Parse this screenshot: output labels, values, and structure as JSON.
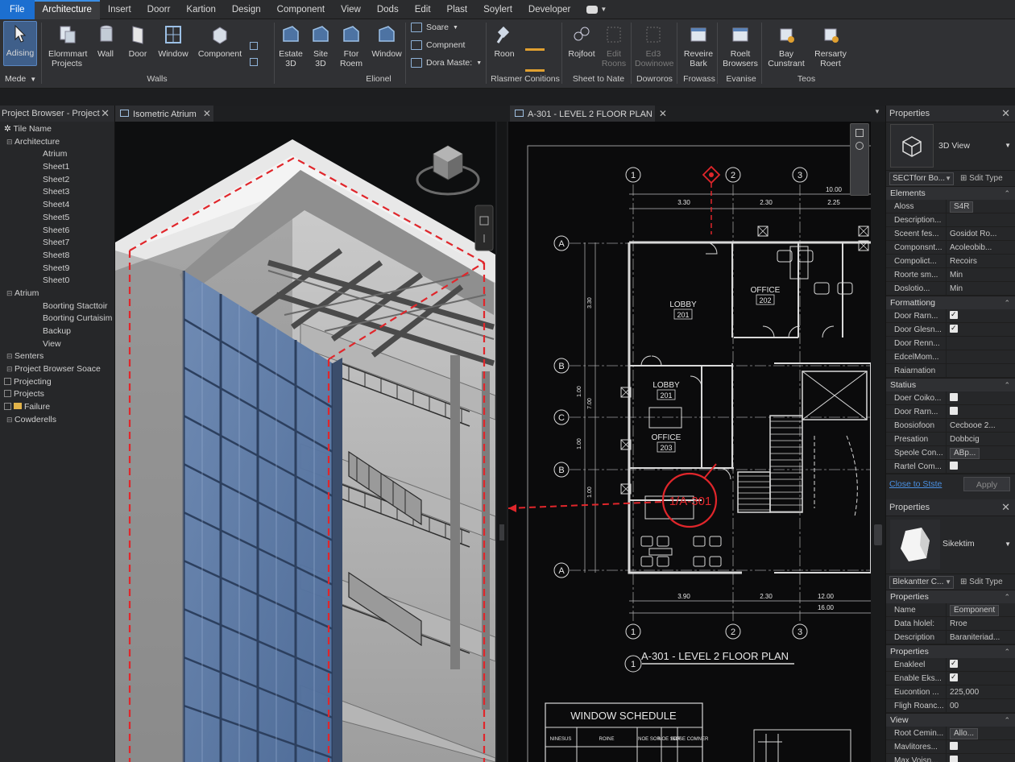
{
  "menu": {
    "items": [
      "File",
      "Architecture",
      "Insert",
      "Doorr",
      "Kartion",
      "Design",
      "Component",
      "View",
      "Dods",
      "Edit",
      "Plast",
      "Soylert",
      "Developer"
    ],
    "active": "Architecture"
  },
  "ribbon": {
    "modify": {
      "label": "Adising",
      "footer": "Mede"
    },
    "buttons": [
      {
        "id": "elements-projects",
        "label": "Elormmart\nProjects"
      },
      {
        "id": "wall",
        "label": "Wall"
      },
      {
        "id": "door",
        "label": "Door"
      },
      {
        "id": "window",
        "label": "Window"
      },
      {
        "id": "component",
        "label": "Component"
      },
      {
        "id": "estate-3d",
        "label": "Estate\n3D"
      },
      {
        "id": "site-3d",
        "label": "Site\n3D"
      },
      {
        "id": "floor-room",
        "label": "Ftor\nRoem"
      },
      {
        "id": "window-2",
        "label": "Window"
      },
      {
        "id": "room",
        "label": "Roon"
      },
      {
        "id": "project",
        "label": "Rojfoot"
      },
      {
        "id": "edit-rooms",
        "label": "Edit\nRoons"
      },
      {
        "id": "edit-dowinowe",
        "label": "Ed3\nDowinowe"
      },
      {
        "id": "review-bark",
        "label": "Reveire\nBark"
      },
      {
        "id": "roelt-browsers",
        "label": "Roelt\nBrowsers"
      },
      {
        "id": "bay-cunstrant",
        "label": "Bay\nCunstrant"
      },
      {
        "id": "rersarty-roert",
        "label": "Rersarty\nRoert"
      }
    ],
    "small_buttons": [
      "Soare",
      "Compnent",
      "Dora Maste:"
    ],
    "groups": [
      "Walls",
      "Elionel",
      "Rlasmer Conitions",
      "Sheet to Nate",
      "Dowroros",
      "Frowass",
      "Evanise",
      "Teos"
    ]
  },
  "project_browser": {
    "title": "Project Browser - Project",
    "tree": [
      {
        "label": "Tile Name",
        "level": 0,
        "icon": "star"
      },
      {
        "label": "Architecture",
        "level": 1
      },
      {
        "label": "Atrium",
        "level": 2
      },
      {
        "label": "Sheet1",
        "level": 2
      },
      {
        "label": "Sheet2",
        "level": 2
      },
      {
        "label": "Sheet3",
        "level": 2
      },
      {
        "label": "Sheet4",
        "level": 2
      },
      {
        "label": "Sheet5",
        "level": 2
      },
      {
        "label": "Sheet6",
        "level": 2
      },
      {
        "label": "Sheet7",
        "level": 2
      },
      {
        "label": "Sheet8",
        "level": 2
      },
      {
        "label": "Sheet9",
        "level": 2
      },
      {
        "label": "Sheet0",
        "level": 2
      },
      {
        "label": "Atrium",
        "level": 1
      },
      {
        "label": "Boorting Stacttoir",
        "level": 2
      },
      {
        "label": "Boorting Curtaisim",
        "level": 2
      },
      {
        "label": "Backup",
        "level": 2
      },
      {
        "label": "View",
        "level": 2
      },
      {
        "label": "Senters",
        "level": 1
      },
      {
        "label": "Project Browser Soace",
        "level": 1
      },
      {
        "label": "Projecting",
        "level": 0,
        "exp": true
      },
      {
        "label": "Projects",
        "level": 0,
        "exp": true
      },
      {
        "label": "Failure",
        "level": 0,
        "exp": true,
        "folder": true
      },
      {
        "label": "Cowderells",
        "level": 1
      }
    ]
  },
  "tabs": {
    "iso": "Isometric Atrium",
    "plan": "A-301 - LEVEL 2 FLOOR PLAN"
  },
  "plan": {
    "title": "A-301 - LEVEL 2 FLOOR PLAN",
    "title_marker": "1",
    "grid_cols": [
      "1",
      "2",
      "3"
    ],
    "grid_rows": [
      "A",
      "B",
      "C",
      "B",
      "A"
    ],
    "top_dims": [
      "3.30",
      "2.30",
      "2.25",
      "10.00"
    ],
    "bottom_dims": [
      "3.90",
      "2.30",
      "12.00",
      "16.00"
    ],
    "side_dims": [
      "3.30",
      "1.00",
      "7.00",
      "1.00",
      "1.00"
    ],
    "rooms": [
      {
        "name": "LOBBY",
        "number": "201"
      },
      {
        "name": "OFFICE",
        "number": "202"
      },
      {
        "name": "LOBBY",
        "number": "201"
      },
      {
        "name": "OFFICE",
        "number": "203"
      }
    ],
    "callout": "1/A-301",
    "schedule": {
      "title": "WINDOW SCHEDULE",
      "headers": [
        "NINESUS",
        "ROINE",
        "NOE\nSOR",
        "NOE\nSOR",
        "ISOSE\nCOMNER"
      ]
    }
  },
  "properties_top": {
    "title": "Properties",
    "type_name": "3D View",
    "selector": "SECTforr Bo...",
    "edit_type": "Sdit Type",
    "sections": [
      {
        "title": "Elements",
        "rows": [
          {
            "k": "Aloss",
            "v": "S4R",
            "input": true
          },
          {
            "k": "Description...",
            "v": ""
          },
          {
            "k": "Sceent fes...",
            "v": "Gosidot Ro..."
          },
          {
            "k": "Componsnt...",
            "v": "Acoleobib..."
          },
          {
            "k": "Compolict...",
            "v": "Recoirs"
          },
          {
            "k": "Roorte sm...",
            "v": "Min"
          },
          {
            "k": "Doslotio...",
            "v": "Min"
          }
        ]
      },
      {
        "title": "Formattiong",
        "rows": [
          {
            "k": "Door Rarn...",
            "v": "",
            "check": "on"
          },
          {
            "k": "Door Glesn...",
            "v": "",
            "check": "on"
          },
          {
            "k": "Door Renn...",
            "v": ""
          },
          {
            "k": "EdcelMom...",
            "v": ""
          },
          {
            "k": "Raiarnation",
            "v": ""
          }
        ]
      },
      {
        "title": "Statius",
        "rows": [
          {
            "k": "Doer Coiko...",
            "v": "",
            "check": "off"
          },
          {
            "k": "Door Rarn...",
            "v": "",
            "check": "off"
          },
          {
            "k": "Boosiofoon",
            "v": "Cecbooe 2..."
          },
          {
            "k": "Presation",
            "v": "Dobbcig"
          },
          {
            "k": "Speole Con...",
            "v": "ABp...",
            "input": true
          },
          {
            "k": "Rartel Com...",
            "v": "",
            "check": "off"
          }
        ]
      }
    ],
    "link": "Close to Stste",
    "apply": "Apply"
  },
  "properties_bottom": {
    "title": "Properties",
    "type_name": "Sikektim",
    "selector": "Blekantter C...",
    "edit_type": "Sdit Type",
    "sections": [
      {
        "title": "Properties",
        "rows": [
          {
            "k": "Name",
            "v": "Eomponent",
            "input": true
          },
          {
            "k": "Data hlolel:",
            "v": "Rroe"
          },
          {
            "k": "Description",
            "v": "Baraniteriad..."
          }
        ]
      },
      {
        "title": "Properties",
        "rows": [
          {
            "k": "Enakleel",
            "v": "",
            "check": "on"
          },
          {
            "k": "Enable Eks...",
            "v": "",
            "check": "on"
          },
          {
            "k": "Eucontion ...",
            "v": "225,000"
          },
          {
            "k": "Fligh Roanc...",
            "v": "00"
          }
        ]
      },
      {
        "title": "View",
        "rows": [
          {
            "k": "Root Cemin...",
            "v": "Allo...",
            "input": true
          },
          {
            "k": "Mavlitores...",
            "v": "",
            "check": "off"
          },
          {
            "k": "Max Voisn...",
            "v": "",
            "check": "off"
          }
        ]
      }
    ]
  },
  "colors": {
    "accent": "#1c6fd0",
    "redline": "#e0262b",
    "glass": "#5b7aa8"
  }
}
